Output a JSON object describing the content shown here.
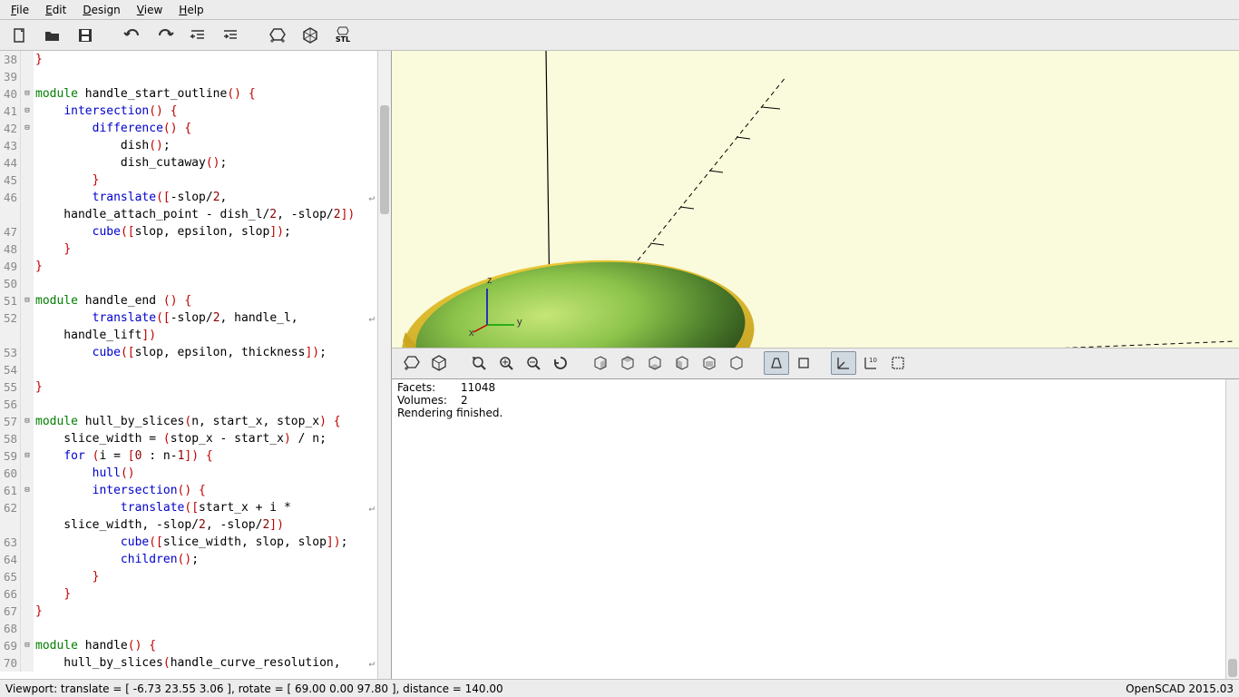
{
  "menu": {
    "file": "File",
    "edit": "Edit",
    "design": "Design",
    "view": "View",
    "help": "Help"
  },
  "toolbar": {
    "new": "new-icon",
    "open": "open-icon",
    "save": "save-icon",
    "undo": "undo-icon",
    "redo": "redo-icon",
    "unindent": "unindent-icon",
    "indent": "indent-icon",
    "preview": "preview-icon",
    "render": "render-icon",
    "export": "STL"
  },
  "code": [
    {
      "n": 38,
      "f": "",
      "html": "<span class='k-red'>}</span>"
    },
    {
      "n": 39,
      "f": "",
      "html": ""
    },
    {
      "n": 40,
      "f": "⊟",
      "html": "<span class='k-green'>module</span> handle_start_outline<span class='k-red'>()</span> <span class='k-red'>{</span>"
    },
    {
      "n": 41,
      "f": "⊟",
      "html": "    <span class='k-blue'>intersection</span><span class='k-red'>()</span> <span class='k-red'>{</span>"
    },
    {
      "n": 42,
      "f": "⊟",
      "html": "        <span class='k-blue'>difference</span><span class='k-red'>()</span> <span class='k-red'>{</span>"
    },
    {
      "n": 43,
      "f": "",
      "html": "            dish<span class='k-red'>()</span>;"
    },
    {
      "n": 44,
      "f": "",
      "html": "            dish_cutaway<span class='k-red'>()</span>;"
    },
    {
      "n": 45,
      "f": "",
      "html": "        <span class='k-red'>}</span>"
    },
    {
      "n": 46,
      "f": "",
      "html": "        <span class='k-blue'>translate</span><span class='k-red'>([</span>-slop/<span class='k-dkred'>2</span>,",
      "wrap": true
    },
    {
      "n": "",
      "f": "",
      "html": "    handle_attach_point - dish_l/<span class='k-dkred'>2</span>, -slop/<span class='k-dkred'>2</span><span class='k-red'>])</span>"
    },
    {
      "n": 47,
      "f": "",
      "html": "        <span class='k-blue'>cube</span><span class='k-red'>([</span>slop, epsilon, slop<span class='k-red'>])</span>;"
    },
    {
      "n": 48,
      "f": "",
      "html": "    <span class='k-red'>}</span>"
    },
    {
      "n": 49,
      "f": "",
      "html": "<span class='k-red'>}</span>"
    },
    {
      "n": 50,
      "f": "",
      "html": ""
    },
    {
      "n": 51,
      "f": "⊟",
      "html": "<span class='k-green'>module</span> handle_end <span class='k-red'>()</span> <span class='k-red'>{</span>"
    },
    {
      "n": 52,
      "f": "",
      "html": "        <span class='k-blue'>translate</span><span class='k-red'>([</span>-slop/<span class='k-dkred'>2</span>, handle_l,",
      "wrap": true
    },
    {
      "n": "",
      "f": "",
      "html": "    handle_lift<span class='k-red'>])</span>"
    },
    {
      "n": 53,
      "f": "",
      "html": "        <span class='k-blue'>cube</span><span class='k-red'>([</span>slop, epsilon, thickness<span class='k-red'>])</span>;"
    },
    {
      "n": 54,
      "f": "",
      "html": ""
    },
    {
      "n": 55,
      "f": "",
      "html": "<span class='k-red'>}</span>"
    },
    {
      "n": 56,
      "f": "",
      "html": ""
    },
    {
      "n": 57,
      "f": "⊟",
      "html": "<span class='k-green'>module</span> hull_by_slices<span class='k-red'>(</span>n, start_x, stop_x<span class='k-red'>)</span> <span class='k-red'>{</span>"
    },
    {
      "n": 58,
      "f": "",
      "html": "    slice_width = <span class='k-red'>(</span>stop_x - start_x<span class='k-red'>)</span> / n;"
    },
    {
      "n": 59,
      "f": "⊟",
      "html": "    <span class='k-blue'>for</span> <span class='k-red'>(</span>i = <span class='k-red'>[</span><span class='k-dkred'>0</span> : n-<span class='k-dkred'>1</span><span class='k-red'>])</span> <span class='k-red'>{</span>"
    },
    {
      "n": 60,
      "f": "",
      "html": "        <span class='k-blue'>hull</span><span class='k-red'>()</span>"
    },
    {
      "n": 61,
      "f": "⊟",
      "html": "        <span class='k-blue'>intersection</span><span class='k-red'>()</span> <span class='k-red'>{</span>"
    },
    {
      "n": 62,
      "f": "",
      "html": "            <span class='k-blue'>translate</span><span class='k-red'>([</span>start_x + i *",
      "wrap": true
    },
    {
      "n": "",
      "f": "",
      "html": "    slice_width, -slop/<span class='k-dkred'>2</span>, -slop/<span class='k-dkred'>2</span><span class='k-red'>])</span>"
    },
    {
      "n": 63,
      "f": "",
      "html": "            <span class='k-blue'>cube</span><span class='k-red'>([</span>slice_width, slop, slop<span class='k-red'>])</span>;"
    },
    {
      "n": 64,
      "f": "",
      "html": "            <span class='k-blue'>children</span><span class='k-red'>()</span>;"
    },
    {
      "n": 65,
      "f": "",
      "html": "        <span class='k-red'>}</span>"
    },
    {
      "n": 66,
      "f": "",
      "html": "    <span class='k-red'>}</span>"
    },
    {
      "n": 67,
      "f": "",
      "html": "<span class='k-red'>}</span>"
    },
    {
      "n": 68,
      "f": "",
      "html": ""
    },
    {
      "n": 69,
      "f": "⊟",
      "html": "<span class='k-green'>module</span> handle<span class='k-red'>()</span> <span class='k-red'>{</span>"
    },
    {
      "n": 70,
      "f": "",
      "html": "    hull_by_slices<span class='k-red'>(</span>handle_curve_resolution,",
      "wrap": true
    }
  ],
  "console": {
    "line1a": "Facets:",
    "line1b": "11048",
    "line2a": "Volumes:",
    "line2b": "2",
    "line3": "Rendering finished."
  },
  "status": {
    "left": "Viewport: translate = [ -6.73 23.55 3.06 ], rotate = [ 69.00 0.00 97.80 ], distance = 140.00",
    "right": "OpenSCAD 2015.03"
  },
  "axes": {
    "x": "x",
    "y": "y",
    "z": "z"
  }
}
